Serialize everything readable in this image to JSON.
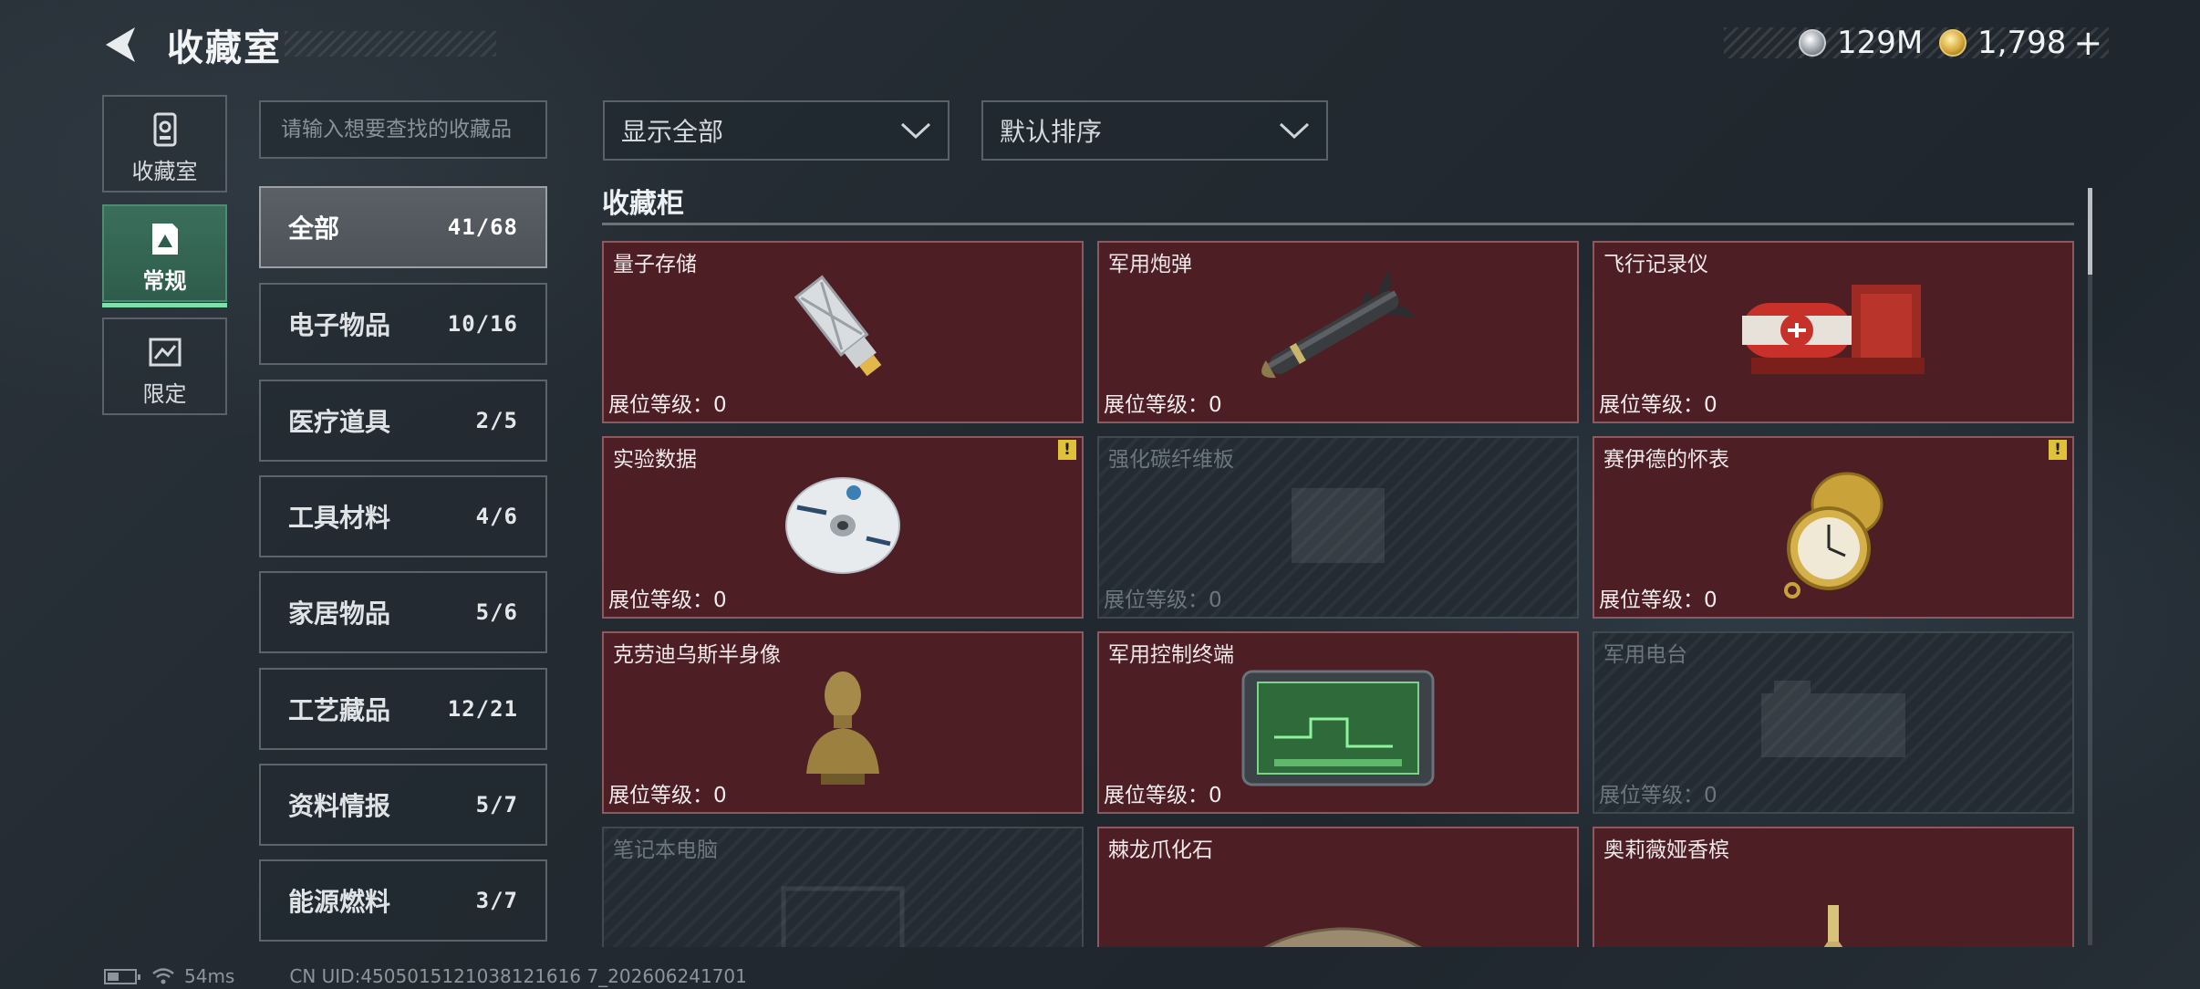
{
  "header": {
    "title": "收藏室",
    "currency_silver": "129M",
    "currency_gold": "1,798",
    "currency_add": "+"
  },
  "nav": [
    {
      "label": "收藏室",
      "icon": "collection-room-icon"
    },
    {
      "label": "常规",
      "icon": "regular-collection-icon"
    },
    {
      "label": "限定",
      "icon": "limited-collection-icon"
    }
  ],
  "search": {
    "placeholder": "请输入想要查找的收藏品"
  },
  "categories": [
    {
      "name": "全部",
      "count": "41/68"
    },
    {
      "name": "电子物品",
      "count": "10/16"
    },
    {
      "name": "医疗道具",
      "count": "2/5"
    },
    {
      "name": "工具材料",
      "count": "4/6"
    },
    {
      "name": "家居物品",
      "count": "5/6"
    },
    {
      "name": "工艺藏品",
      "count": "12/21"
    },
    {
      "name": "资料情报",
      "count": "5/7"
    },
    {
      "name": "能源燃料",
      "count": "3/7"
    }
  ],
  "filter": {
    "label": "显示全部"
  },
  "sort": {
    "label": "默认排序"
  },
  "section": {
    "title": "收藏柜"
  },
  "level_label": "展位等级：",
  "items": [
    {
      "name": "量子存储",
      "level": "0",
      "locked": false,
      "alert": false,
      "icon": "usb-drive-icon"
    },
    {
      "name": "军用炮弹",
      "level": "0",
      "locked": false,
      "alert": false,
      "icon": "missile-icon"
    },
    {
      "name": "飞行记录仪",
      "level": "0",
      "locked": false,
      "alert": false,
      "icon": "flight-recorder-icon"
    },
    {
      "name": "实验数据",
      "level": "0",
      "locked": false,
      "alert": true,
      "icon": "disc-icon"
    },
    {
      "name": "强化碳纤维板",
      "level": "0",
      "locked": true,
      "alert": false,
      "icon": "carbon-plate-icon"
    },
    {
      "name": "赛伊德的怀表",
      "level": "0",
      "locked": false,
      "alert": true,
      "icon": "pocket-watch-icon"
    },
    {
      "name": "克劳迪乌斯半身像",
      "level": "0",
      "locked": false,
      "alert": false,
      "icon": "bust-statue-icon"
    },
    {
      "name": "军用控制终端",
      "level": "0",
      "locked": false,
      "alert": false,
      "icon": "control-terminal-icon"
    },
    {
      "name": "军用电台",
      "level": "0",
      "locked": true,
      "alert": false,
      "icon": "radio-icon"
    },
    {
      "name": "笔记本电脑",
      "level": "",
      "locked": true,
      "alert": false,
      "icon": "laptop-icon"
    },
    {
      "name": "棘龙爪化石",
      "level": "",
      "locked": false,
      "alert": false,
      "icon": "claw-fossil-icon"
    },
    {
      "name": "奥莉薇娅香槟",
      "level": "",
      "locked": false,
      "alert": false,
      "icon": "champagne-icon"
    }
  ],
  "alert_mark": "!",
  "footer": {
    "ping": "54ms",
    "uid": "CN UID:4505015121038121616 7_202606241701"
  }
}
